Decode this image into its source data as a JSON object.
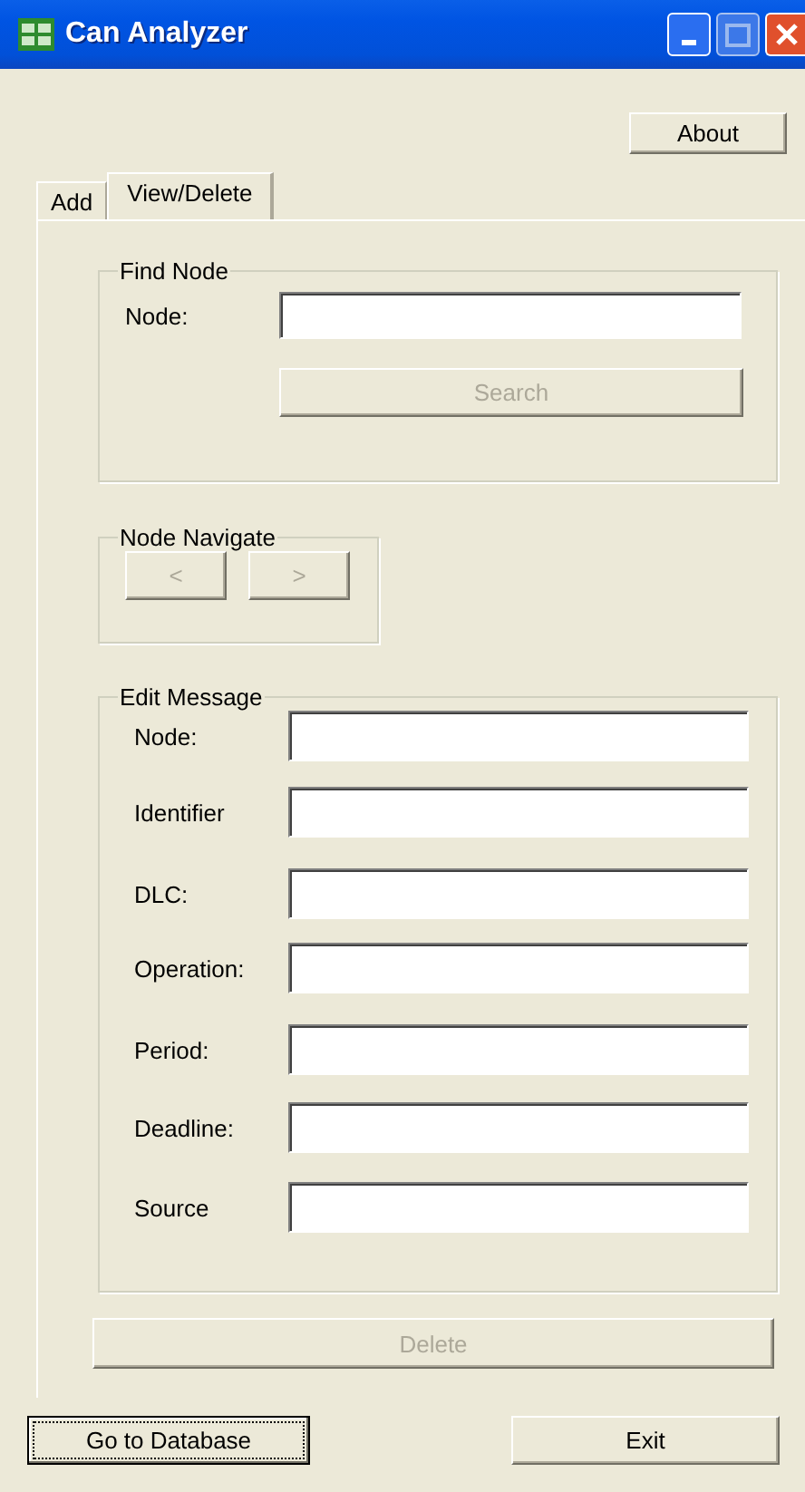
{
  "window": {
    "title": "Can Analyzer"
  },
  "about_button": {
    "label": "About"
  },
  "tabs": [
    {
      "label": "Add",
      "selected": false
    },
    {
      "label": "View/Delete",
      "selected": true
    }
  ],
  "find_node": {
    "title": "Find Node",
    "label": "Node:",
    "search_button": {
      "label": "Search",
      "disabled": true
    }
  },
  "node_navigate": {
    "title": "Node Navigate",
    "buttons": [
      {
        "label": "<",
        "disabled": true
      },
      {
        "label": ">",
        "disabled": true
      }
    ]
  },
  "edit_message": {
    "title": "Edit Message",
    "fields": [
      {
        "label": "Node:"
      },
      {
        "label": "Identifier"
      },
      {
        "label": "DLC:"
      },
      {
        "label": "Operation:"
      },
      {
        "label": "Period:"
      },
      {
        "label": "Deadline:"
      },
      {
        "label": "Source"
      }
    ]
  },
  "delete_button": {
    "label": "Delete",
    "disabled": true
  },
  "footer_buttons": [
    {
      "label": "Go to Database",
      "focused": true
    },
    {
      "label": "Exit",
      "focused": false
    }
  ]
}
